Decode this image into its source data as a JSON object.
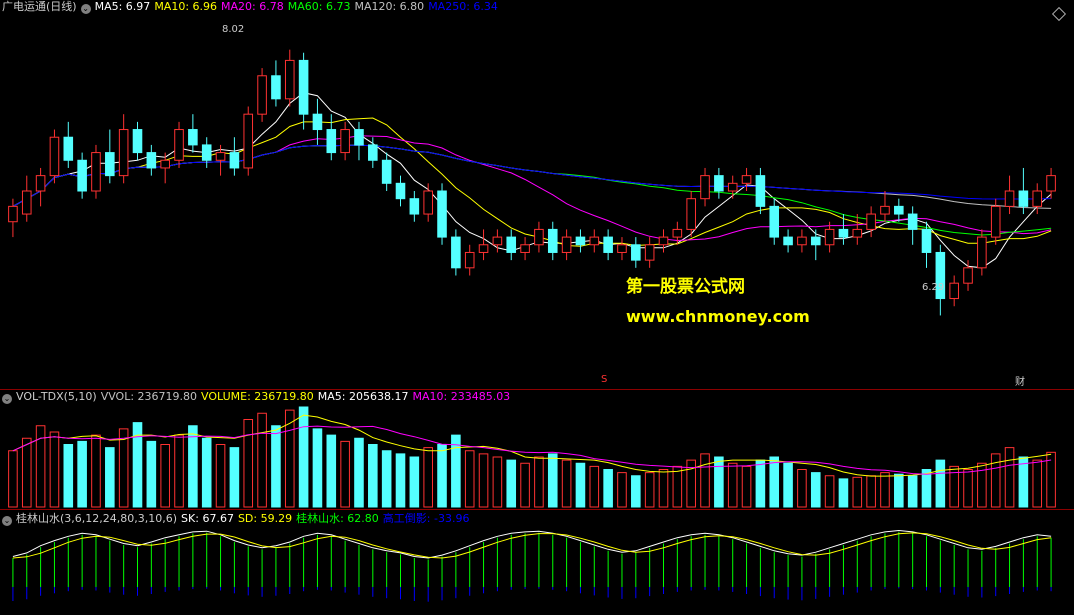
{
  "header": {
    "stock_name": "广电运通(日线)",
    "ma": [
      {
        "label": "MA5: 6.97",
        "color": "#ffffff"
      },
      {
        "label": "MA10: 6.96",
        "color": "#ffff00"
      },
      {
        "label": "MA20: 6.78",
        "color": "#ff00ff"
      },
      {
        "label": "MA60: 6.73",
        "color": "#00ff00"
      },
      {
        "label": "MA120: 6.80",
        "color": "#c0c0c0"
      },
      {
        "label": "MA250: 6.34",
        "color": "#0000ff"
      }
    ]
  },
  "volume_header": {
    "title": "VOL-TDX(5,10)",
    "items": [
      {
        "label": "VVOL: 236719.80",
        "color": "#c0c0c0"
      },
      {
        "label": "VOLUME: 236719.80",
        "color": "#ffff00"
      },
      {
        "label": "MA5: 205638.17",
        "color": "#ffffff"
      },
      {
        "label": "MA10: 233485.03",
        "color": "#ff00ff"
      }
    ]
  },
  "indicator_header": {
    "title": "桂林山水(3,6,12,24,80,3,10,6)",
    "items": [
      {
        "label": "SK: 67.67",
        "color": "#ffffff"
      },
      {
        "label": "SD: 59.29",
        "color": "#ffff00"
      },
      {
        "label": "桂林山水: 62.80",
        "color": "#00ff00"
      },
      {
        "label": "高工倒影: -33.96",
        "color": "#0000ff"
      }
    ]
  },
  "annotations": {
    "high_label": "8.02",
    "low_label": "6.29",
    "marker_s": "S",
    "marker_cai": "财"
  },
  "watermark": {
    "line1": "第一股票公式网",
    "line2": "www.chnmoney.com"
  },
  "colors": {
    "up": "#ff3232",
    "down": "#54ffff",
    "grid": "#8b0000",
    "ma5": "#ffffff",
    "ma10": "#ffff00",
    "ma20": "#ff00ff",
    "ma60": "#00ff00",
    "ma120": "#c0c0c0",
    "ma250": "#0000ff"
  },
  "chart_data": {
    "type": "candlestick",
    "title": "广电运通(日线)",
    "y_range": [
      6.0,
      8.2
    ],
    "candles": [
      [
        6.9,
        7.0,
        6.8,
        7.05
      ],
      [
        6.95,
        7.1,
        6.9,
        7.2
      ],
      [
        7.1,
        7.2,
        7.0,
        7.25
      ],
      [
        7.2,
        7.45,
        7.15,
        7.5
      ],
      [
        7.45,
        7.3,
        7.25,
        7.55
      ],
      [
        7.3,
        7.1,
        7.05,
        7.35
      ],
      [
        7.1,
        7.35,
        7.05,
        7.4
      ],
      [
        7.35,
        7.2,
        7.15,
        7.5
      ],
      [
        7.2,
        7.5,
        7.15,
        7.6
      ],
      [
        7.5,
        7.35,
        7.3,
        7.55
      ],
      [
        7.35,
        7.25,
        7.2,
        7.4
      ],
      [
        7.25,
        7.3,
        7.15,
        7.35
      ],
      [
        7.3,
        7.5,
        7.25,
        7.55
      ],
      [
        7.5,
        7.4,
        7.35,
        7.6
      ],
      [
        7.4,
        7.3,
        7.25,
        7.45
      ],
      [
        7.3,
        7.35,
        7.2,
        7.4
      ],
      [
        7.35,
        7.25,
        7.2,
        7.45
      ],
      [
        7.25,
        7.6,
        7.2,
        7.65
      ],
      [
        7.6,
        7.85,
        7.55,
        7.9
      ],
      [
        7.85,
        7.7,
        7.65,
        7.95
      ],
      [
        7.7,
        7.95,
        7.65,
        8.02
      ],
      [
        7.95,
        7.6,
        7.5,
        8.0
      ],
      [
        7.6,
        7.5,
        7.4,
        7.7
      ],
      [
        7.5,
        7.35,
        7.3,
        7.6
      ],
      [
        7.35,
        7.5,
        7.3,
        7.55
      ],
      [
        7.5,
        7.4,
        7.3,
        7.55
      ],
      [
        7.4,
        7.3,
        7.25,
        7.45
      ],
      [
        7.3,
        7.15,
        7.1,
        7.35
      ],
      [
        7.15,
        7.05,
        7.0,
        7.2
      ],
      [
        7.05,
        6.95,
        6.9,
        7.1
      ],
      [
        6.95,
        7.1,
        6.9,
        7.15
      ],
      [
        7.1,
        6.8,
        6.75,
        7.15
      ],
      [
        6.8,
        6.6,
        6.55,
        6.85
      ],
      [
        6.6,
        6.7,
        6.55,
        6.75
      ],
      [
        6.7,
        6.75,
        6.65,
        6.85
      ],
      [
        6.75,
        6.8,
        6.7,
        6.85
      ],
      [
        6.8,
        6.7,
        6.65,
        6.85
      ],
      [
        6.7,
        6.75,
        6.65,
        6.8
      ],
      [
        6.75,
        6.85,
        6.7,
        6.9
      ],
      [
        6.85,
        6.7,
        6.65,
        6.9
      ],
      [
        6.7,
        6.8,
        6.65,
        6.85
      ],
      [
        6.8,
        6.75,
        6.7,
        6.85
      ],
      [
        6.75,
        6.8,
        6.7,
        6.85
      ],
      [
        6.8,
        6.7,
        6.65,
        6.85
      ],
      [
        6.7,
        6.75,
        6.65,
        6.8
      ],
      [
        6.75,
        6.65,
        6.6,
        6.8
      ],
      [
        6.65,
        6.75,
        6.6,
        6.8
      ],
      [
        6.75,
        6.8,
        6.7,
        6.85
      ],
      [
        6.8,
        6.85,
        6.75,
        6.9
      ],
      [
        6.85,
        7.05,
        6.8,
        7.1
      ],
      [
        7.05,
        7.2,
        7.0,
        7.25
      ],
      [
        7.2,
        7.1,
        7.05,
        7.25
      ],
      [
        7.1,
        7.15,
        7.05,
        7.2
      ],
      [
        7.15,
        7.2,
        7.1,
        7.25
      ],
      [
        7.2,
        7.0,
        6.95,
        7.25
      ],
      [
        7.0,
        6.8,
        6.75,
        7.05
      ],
      [
        6.8,
        6.75,
        6.7,
        6.85
      ],
      [
        6.75,
        6.8,
        6.7,
        6.85
      ],
      [
        6.8,
        6.75,
        6.65,
        6.85
      ],
      [
        6.75,
        6.85,
        6.7,
        6.9
      ],
      [
        6.85,
        6.8,
        6.75,
        6.95
      ],
      [
        6.8,
        6.85,
        6.75,
        6.95
      ],
      [
        6.85,
        6.95,
        6.8,
        7.0
      ],
      [
        6.95,
        7.0,
        6.9,
        7.1
      ],
      [
        7.0,
        6.95,
        6.9,
        7.05
      ],
      [
        6.95,
        6.85,
        6.75,
        7.0
      ],
      [
        6.85,
        6.7,
        6.6,
        6.9
      ],
      [
        6.7,
        6.4,
        6.29,
        6.75
      ],
      [
        6.4,
        6.5,
        6.35,
        6.55
      ],
      [
        6.5,
        6.6,
        6.45,
        6.65
      ],
      [
        6.6,
        6.8,
        6.55,
        6.85
      ],
      [
        6.8,
        7.0,
        6.75,
        7.05
      ],
      [
        7.0,
        7.1,
        6.95,
        7.2
      ],
      [
        7.1,
        7.0,
        6.95,
        7.25
      ],
      [
        7.0,
        7.1,
        6.95,
        7.15
      ],
      [
        7.1,
        7.2,
        7.05,
        7.25
      ]
    ],
    "volume": [
      180,
      220,
      260,
      240,
      200,
      210,
      230,
      190,
      250,
      270,
      210,
      200,
      230,
      260,
      220,
      200,
      190,
      280,
      300,
      260,
      310,
      320,
      250,
      230,
      210,
      220,
      200,
      180,
      170,
      160,
      190,
      200,
      230,
      180,
      170,
      160,
      150,
      140,
      160,
      170,
      150,
      140,
      130,
      120,
      110,
      100,
      110,
      120,
      130,
      150,
      170,
      160,
      140,
      130,
      150,
      160,
      140,
      120,
      110,
      100,
      90,
      95,
      100,
      110,
      105,
      100,
      120,
      150,
      130,
      120,
      140,
      170,
      190,
      160,
      150,
      175
    ],
    "indicator": [
      40,
      45,
      55,
      62,
      68,
      72,
      70,
      64,
      58,
      55,
      60,
      66,
      70,
      74,
      75,
      70,
      62,
      56,
      52,
      55,
      60,
      68,
      72,
      70,
      64,
      58,
      52,
      48,
      45,
      40,
      38,
      42,
      48,
      55,
      62,
      68,
      72,
      74,
      75,
      72,
      68,
      62,
      56,
      50,
      46,
      48,
      54,
      60,
      66,
      70,
      72,
      70,
      66,
      60,
      54,
      48,
      44,
      42,
      46,
      52,
      58,
      64,
      70,
      74,
      76,
      74,
      70,
      64,
      58,
      52,
      50,
      54,
      60,
      66,
      70,
      68
    ]
  }
}
